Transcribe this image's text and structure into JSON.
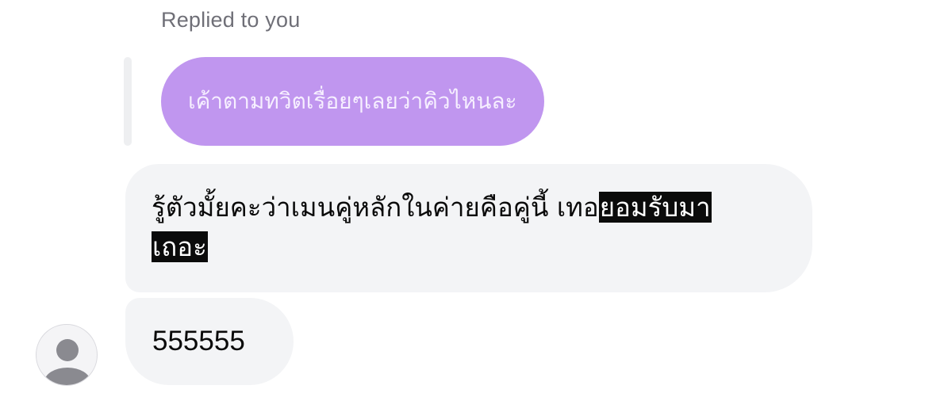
{
  "reply_header": {
    "label": "Replied to you"
  },
  "quoted_message": {
    "text": "เค้าตามทวิตเรื่อยๆเลยว่าคิวไหนละ"
  },
  "messages": [
    {
      "line1_plain": "รู้ตัวมั้ยคะว่าเมนคู่หลักในค่ายคือคู่นี้ เทอ",
      "line1_highlight": "ยอมรับมา",
      "line2_highlight": "เถอะ"
    },
    {
      "text": "555555"
    }
  ],
  "sender": {
    "avatar_icon": "default-user-icon"
  },
  "colors": {
    "quoted_bubble": "#c096ef",
    "received_bubble": "#f3f4f6",
    "highlight": "#0b0b0b"
  }
}
